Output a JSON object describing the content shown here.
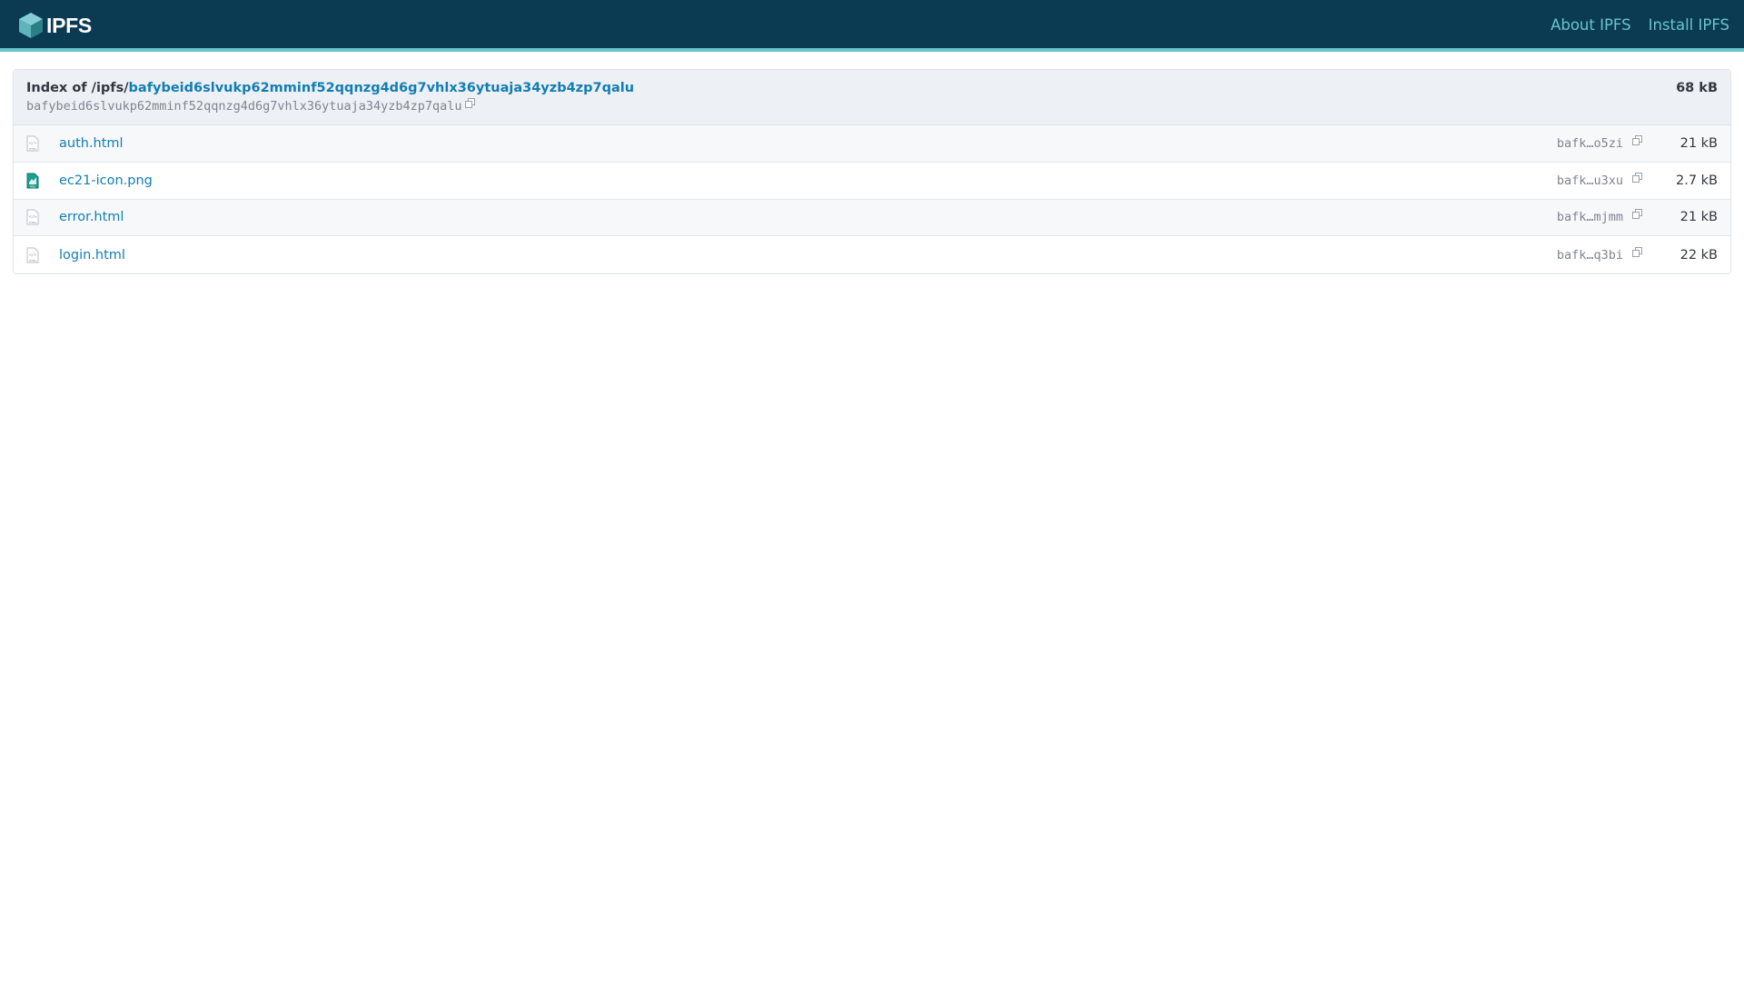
{
  "header": {
    "logo_text": "IPFS",
    "nav": [
      {
        "label": "About IPFS"
      },
      {
        "label": "Install IPFS"
      }
    ]
  },
  "listing": {
    "index_prefix": "Index of /ipfs/",
    "root_cid": "bafybeid6slvukp62mminf52qqnzg4d6g7vhlx36ytuaja34yzb4zp7qalu",
    "cid": "bafybeid6slvukp62mminf52qqnzg4d6g7vhlx36ytuaja34yzb4zp7qalu",
    "total_size": "68 kB",
    "files": [
      {
        "name": "auth.html",
        "short_cid": "bafk…o5zi",
        "size": "21 kB",
        "type": "html"
      },
      {
        "name": "ec21-icon.png",
        "short_cid": "bafk…u3xu",
        "size": "2.7 kB",
        "type": "png"
      },
      {
        "name": "error.html",
        "short_cid": "bafk…mjmm",
        "size": "21 kB",
        "type": "html"
      },
      {
        "name": "login.html",
        "short_cid": "bafk…q3bi",
        "size": "22 kB",
        "type": "html"
      }
    ]
  },
  "colors": {
    "header_bg": "#0b3a53",
    "accent": "#69c4cd",
    "link": "#117eb3"
  }
}
